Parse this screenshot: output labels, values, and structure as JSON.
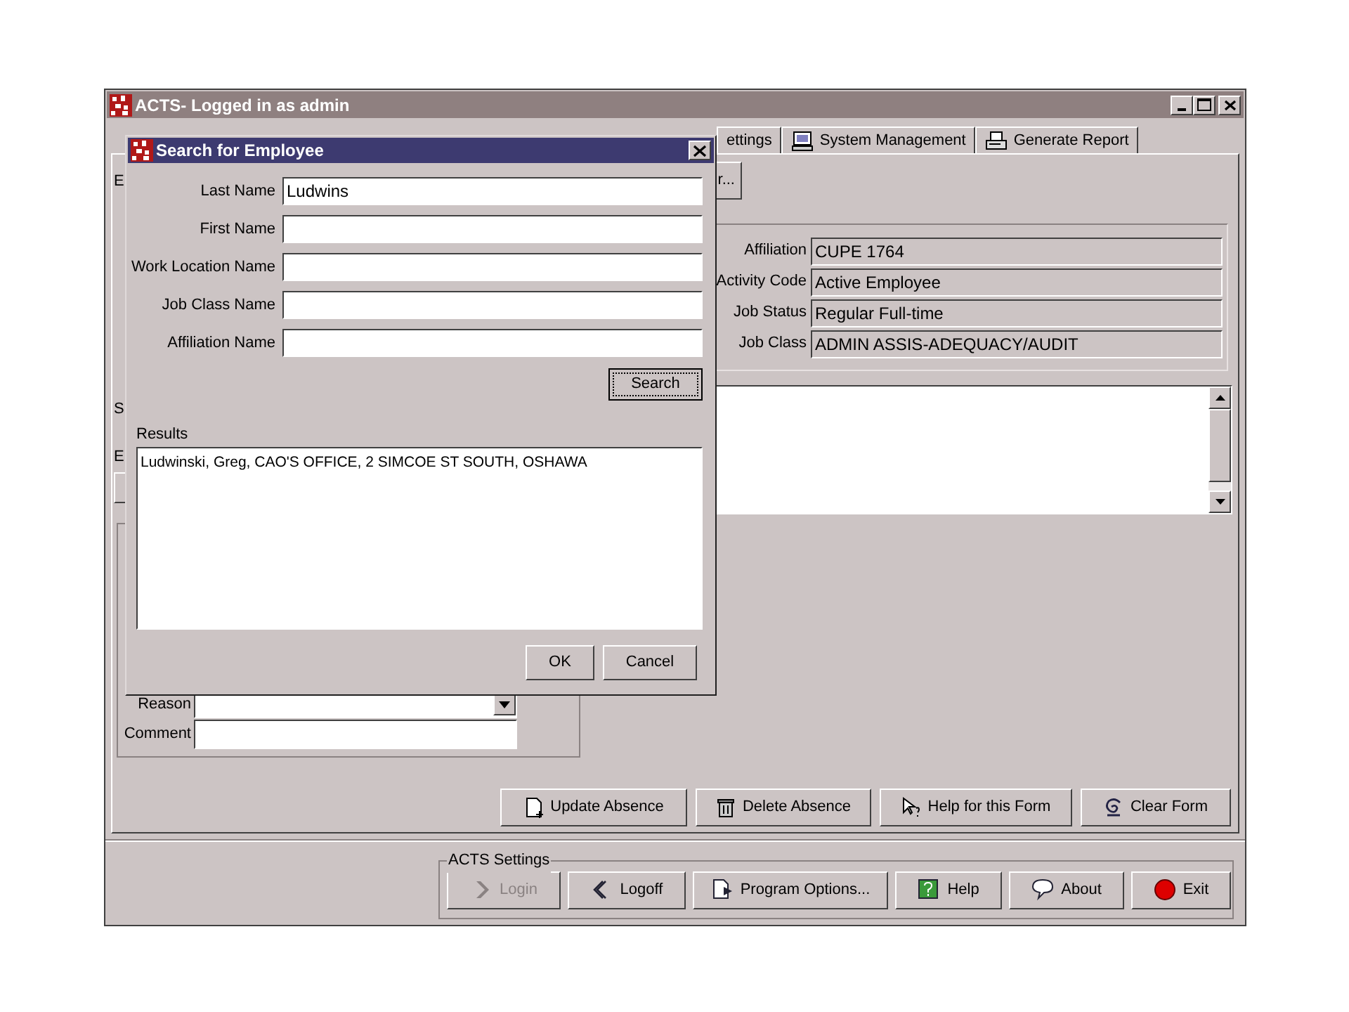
{
  "window": {
    "title": "ACTS- Logged in as admin"
  },
  "tabs": [
    {
      "label": "ettings",
      "selected": false
    },
    {
      "label": "System Management",
      "selected": false
    },
    {
      "label": "Generate Report",
      "selected": false
    }
  ],
  "partial_button": "r...",
  "left_labels": [
    "E",
    "S",
    "E"
  ],
  "employee_details": [
    {
      "label": "Affiliation",
      "value": "CUPE 1764"
    },
    {
      "label": "Activity Code",
      "value": "Active Employee"
    },
    {
      "label": "Job Status",
      "value": "Regular Full-time"
    },
    {
      "label": "Job Class",
      "value": "ADMIN ASSIS-ADEQUACY/AUDIT"
    }
  ],
  "absence": {
    "reason_label": "Reason",
    "comment_label": "Comment"
  },
  "form_buttons": [
    "Update Absence",
    "Delete Absence",
    "Help for this Form",
    "Clear Form"
  ],
  "settings": {
    "title": "ACTS Settings",
    "buttons": [
      {
        "label": "Login",
        "disabled": true
      },
      {
        "label": "Logoff",
        "disabled": false
      },
      {
        "label": "Program Options...",
        "disabled": false
      },
      {
        "label": "Help",
        "disabled": false
      },
      {
        "label": "About",
        "disabled": false
      },
      {
        "label": "Exit",
        "disabled": false
      }
    ]
  },
  "dialog": {
    "title": "Search for Employee",
    "fields": [
      {
        "label": "Last Name",
        "value": "Ludwins"
      },
      {
        "label": "First Name"
      },
      {
        "label": "Work Location Name"
      },
      {
        "label": "Job Class Name"
      },
      {
        "label": "Affiliation Name"
      }
    ],
    "search_button": "Search",
    "results_label": "Results",
    "results": [
      "Ludwinski, Greg, CAO'S OFFICE, 2 SIMCOE ST SOUTH, OSHAWA"
    ],
    "buttons": [
      "OK",
      "Cancel"
    ]
  }
}
